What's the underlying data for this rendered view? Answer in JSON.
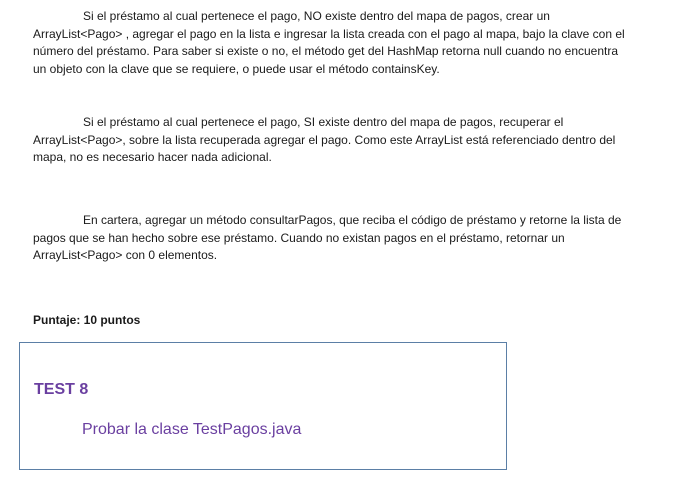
{
  "paragraphs": [
    "Si el préstamo al cual pertenece el pago, NO existe dentro del mapa de pagos, crear un ArrayList<Pago> , agregar el pago en la lista e ingresar la lista creada con el pago al mapa, bajo la clave con el número del préstamo. Para saber si existe o no, el método get del HashMap retorna null cuando no encuentra un objeto con la clave que se requiere, o puede usar el método containsKey.",
    "Si el préstamo al cual pertenece el pago, SI existe dentro del mapa de pagos, recuperar el ArrayList<Pago>, sobre la lista recuperada agregar el pago. Como este ArrayList está referenciado dentro del mapa, no es necesario hacer nada adicional.",
    "En cartera, agregar un método consultarPagos, que reciba el código de préstamo y retorne la lista de pagos que se han hecho sobre ese préstamo. Cuando no existan pagos en el préstamo, retornar un ArrayList<Pago> con 0 elementos."
  ],
  "score": "Puntaje: 10 puntos",
  "test": {
    "title": "TEST 8",
    "description": "Probar la clase TestPagos.java"
  },
  "colors": {
    "accent": "#6a3fa0",
    "box_border": "#5b7fa6",
    "text": "#1a1a1a"
  }
}
